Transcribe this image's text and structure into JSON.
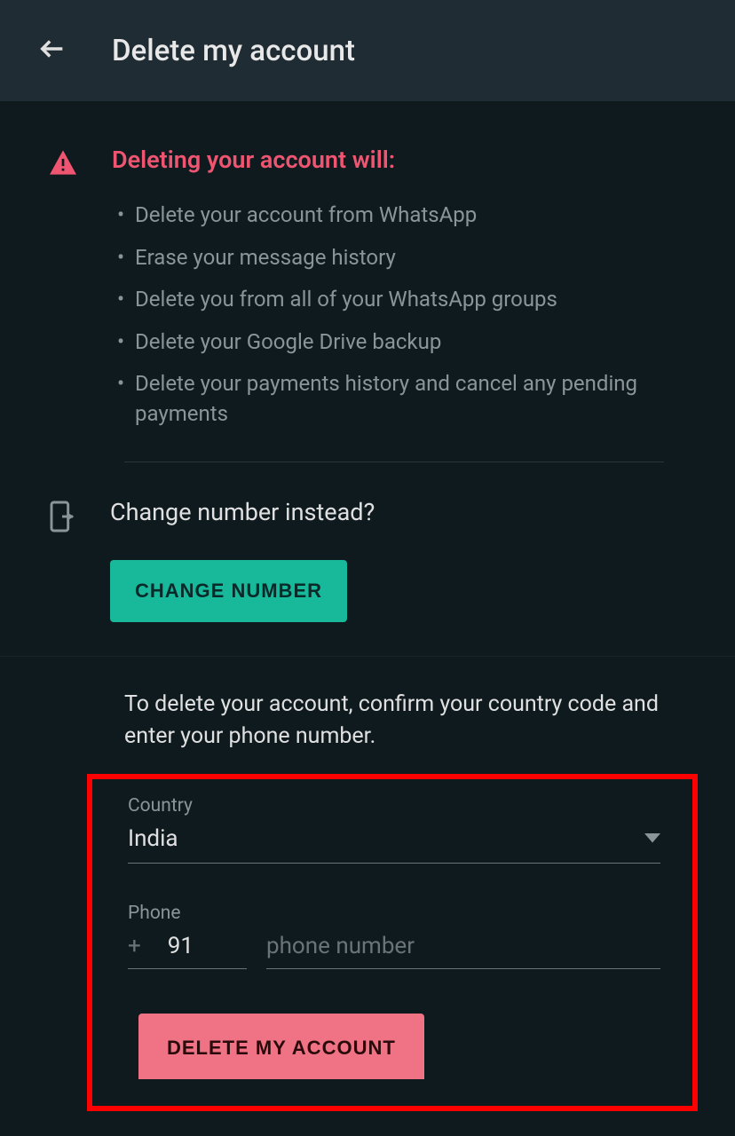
{
  "header": {
    "title": "Delete my account"
  },
  "warning": {
    "title": "Deleting your account will:",
    "items": [
      "Delete your account from WhatsApp",
      "Erase your message history",
      "Delete you from all of your WhatsApp groups",
      "Delete your Google Drive backup",
      "Delete your payments history and cancel any pending payments"
    ]
  },
  "change": {
    "prompt": "Change number instead?",
    "button": "CHANGE NUMBER"
  },
  "form": {
    "instruction": "To delete your account, confirm your country code and enter your phone number.",
    "country_label": "Country",
    "country_value": "India",
    "phone_label": "Phone",
    "plus": "+",
    "country_code": "91",
    "phone_placeholder": "phone number",
    "delete_button": "DELETE MY ACCOUNT"
  }
}
